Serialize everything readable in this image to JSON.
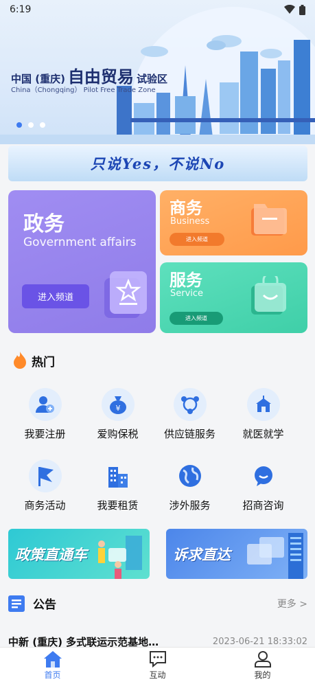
{
  "status_bar": {
    "time": "6:19",
    "wifi_icon": "wifi-icon",
    "battery_icon": "battery-icon"
  },
  "banner": {
    "title_prefix": "中国 (重庆)",
    "title_main": "自由贸易",
    "title_suffix": "试验区",
    "subtitle": "China（Chongqing） Pilot Free Trade Zone",
    "page_count": 3,
    "active_page": 1
  },
  "slogan": "只说Yes，不说No",
  "cards": {
    "gov": {
      "title": "政务",
      "subtitle": "Government affairs",
      "enter": "进入频道",
      "icon": "badge-icon"
    },
    "biz": {
      "title": "商务",
      "subtitle": "Business",
      "enter": "进入频道",
      "icon": "folder-icon"
    },
    "svc": {
      "title": "服务",
      "subtitle": "Service",
      "enter": "进入频道",
      "icon": "bag-icon"
    }
  },
  "hot": {
    "title": "热门",
    "icon": "flame-icon",
    "items": [
      {
        "label": "我要注册",
        "icon": "add-user-icon"
      },
      {
        "label": "爱购保税",
        "icon": "money-bag-icon"
      },
      {
        "label": "供应链服务",
        "icon": "network-icon"
      },
      {
        "label": "就医就学",
        "icon": "school-icon"
      },
      {
        "label": "商务活动",
        "icon": "flag-icon"
      },
      {
        "label": "我要租赁",
        "icon": "buildings-icon"
      },
      {
        "label": "涉外服务",
        "icon": "globe-icon"
      },
      {
        "label": "招商咨询",
        "icon": "chat-icon"
      }
    ]
  },
  "promos": [
    {
      "label": "政策直通车"
    },
    {
      "label": "诉求直达"
    }
  ],
  "notice": {
    "title": "公告",
    "icon": "notice-icon",
    "more": "更多 >",
    "items": [
      {
        "title": "中新 (重庆) 多式联运示范基地…",
        "time": "2023-06-21 18:33:02"
      }
    ]
  },
  "bottom_nav": [
    {
      "label": "首页",
      "icon": "home-icon",
      "active": true
    },
    {
      "label": "互动",
      "icon": "message-icon",
      "active": false
    },
    {
      "label": "我的",
      "icon": "user-icon",
      "active": false
    }
  ],
  "colors": {
    "accent": "#3e7bf0",
    "gov_card": "#9a87f0",
    "biz_card": "#ffa357",
    "svc_card": "#48d6af"
  }
}
